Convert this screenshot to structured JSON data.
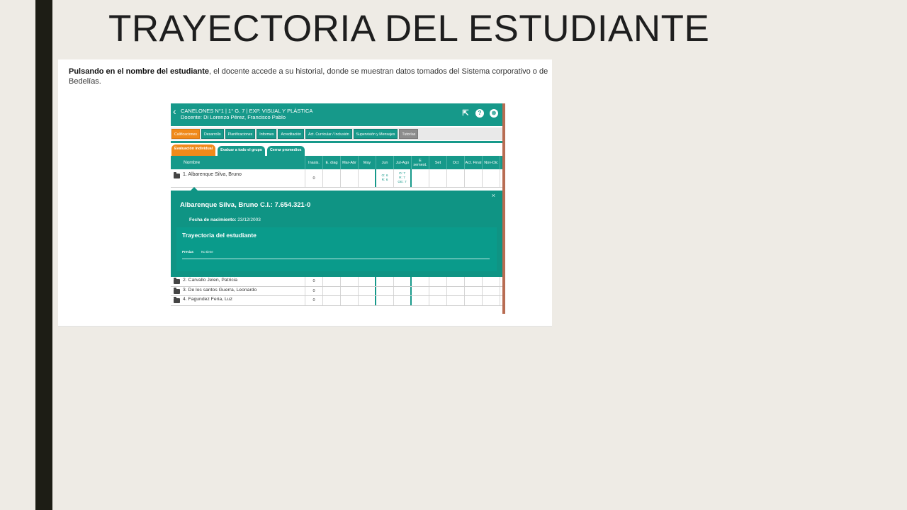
{
  "slide": {
    "title": "TRAYECTORIA DEL ESTUDIANTE"
  },
  "doc": {
    "intro_bold": "Pulsando en el nombre del estudiante",
    "intro_rest": ", el docente accede a su historial, donde se muestran datos tomados del Sistema corporativo o de",
    "intro_line2": "Bedelías."
  },
  "app": {
    "header": {
      "line1": "CANELONES N°1 | 1° G. 7 | EXP. VISUAL Y PLÁSTICA",
      "line2": "Docente: Di Lorenzo Pérez, Francisco Pablo"
    },
    "tabs": [
      "Calificaciones",
      "Desarrollo",
      "Planificaciones",
      "Informes",
      "Acreditación",
      "Act. Curricular / Inclusión",
      "Supervisión y Mensajes",
      "Tutorías"
    ],
    "subtabs": [
      "Evaluación individual",
      "Evaluar a todo el grupo",
      "Cerrar promedios"
    ],
    "columns": [
      "Nombre",
      "Inasis.",
      "E. diag",
      "Mar-Abr",
      "May",
      "Jun",
      "Jul-Ago",
      "E semest.",
      "Set",
      "Oct",
      "Act. Final",
      "Nov-Dic"
    ],
    "first_row": {
      "name": "1. Albarenque Silva, Bruno",
      "inasis": "0",
      "jun": [
        "O: 6",
        "R: 6"
      ],
      "julago": [
        "O: 7",
        "R: 7",
        "OE: 7"
      ]
    },
    "popup": {
      "close": "×",
      "name_ci": "Albarenque Silva, Bruno C.I.: 7.654.321-0",
      "dob_label": "Fecha de nacimiento:",
      "dob_value": "23/12/2003",
      "trayectoria": "Trayectoria del estudiante",
      "previas_label": "Previas",
      "previas_value": "No tiene"
    },
    "rows": [
      {
        "name": "2. Carvallo Jelen, Patricia",
        "inasis": "0"
      },
      {
        "name": "3. De los santos Guerra, Leonardo",
        "inasis": "0"
      },
      {
        "name": "4. Fagundez Feria, Luz",
        "inasis": "0"
      }
    ]
  }
}
